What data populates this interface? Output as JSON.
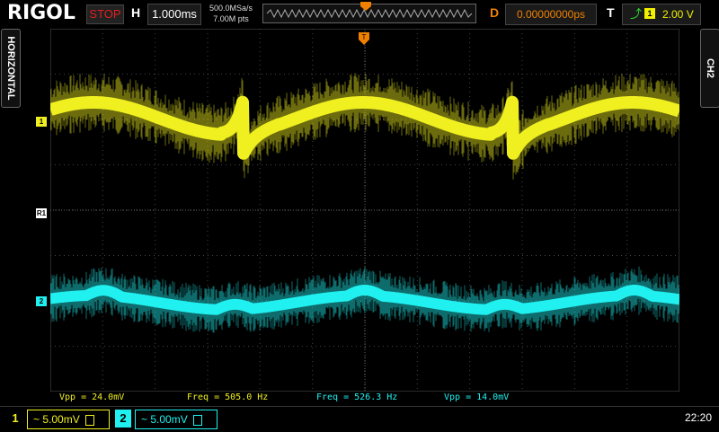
{
  "header": {
    "brand": "RIGOL",
    "run_state": "STOP",
    "h_label": "H",
    "timebase": "1.000ms",
    "sample_rate": "500.0MSa/s",
    "memory_depth": "7.00M pts",
    "d_label": "D",
    "delay": "0.00000000ps",
    "t_label": "T",
    "trigger_source": "1",
    "trigger_level": "2.00 V"
  },
  "side": {
    "left_tab": "HORIZONTAL",
    "right_tab": "CH2"
  },
  "markers": {
    "ch1": "1",
    "ch2": "2",
    "ref": "R1"
  },
  "measurements": {
    "ch1_vpp": "Vpp = 24.0mV",
    "ch1_freq": "Freq = 505.0 Hz",
    "ch2_freq": "Freq = 526.3 Hz",
    "ch2_vpp": "Vpp = 14.0mV"
  },
  "channels": [
    {
      "id": "1",
      "scale": "~ 5.00mV",
      "color": "#f0f020"
    },
    {
      "id": "2",
      "scale": "~ 5.00mV",
      "color": "#20f0f0"
    }
  ],
  "clock": "22:20",
  "colors": {
    "ch1": "#f0f020",
    "ch2": "#20f0f0",
    "accent_orange": "#f08000",
    "stop_red": "#e02020"
  }
}
